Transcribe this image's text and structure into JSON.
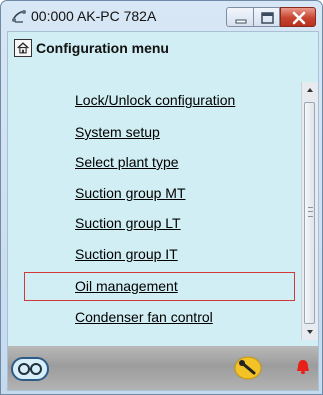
{
  "window": {
    "title": "00:000 AK-PC 782A",
    "icon": "network-icon",
    "controls": [
      "minimize-icon",
      "maximize-icon",
      "close-icon"
    ]
  },
  "menu": {
    "title": "Configuration menu",
    "home_icon": "home-icon",
    "items": [
      {
        "label": "Lock/Unlock configuration"
      },
      {
        "label": "System setup"
      },
      {
        "label": "Select plant type"
      },
      {
        "label": "Suction group MT"
      },
      {
        "label": "Suction group LT"
      },
      {
        "label": "Suction group IT"
      },
      {
        "label": "Oil management"
      },
      {
        "label": "Condenser fan control"
      }
    ],
    "selected_item": "Oil management"
  },
  "statusbar": {
    "left_icon": "glasses-icon",
    "tool_icon": "wrench-icon",
    "alarm_icon": "alarm-bell-icon"
  },
  "colors": {
    "client_bg": "#d0eef3",
    "selection_border": "#d03a3a",
    "alarm": "#e8201a",
    "tool_badge": "#f3c227"
  }
}
